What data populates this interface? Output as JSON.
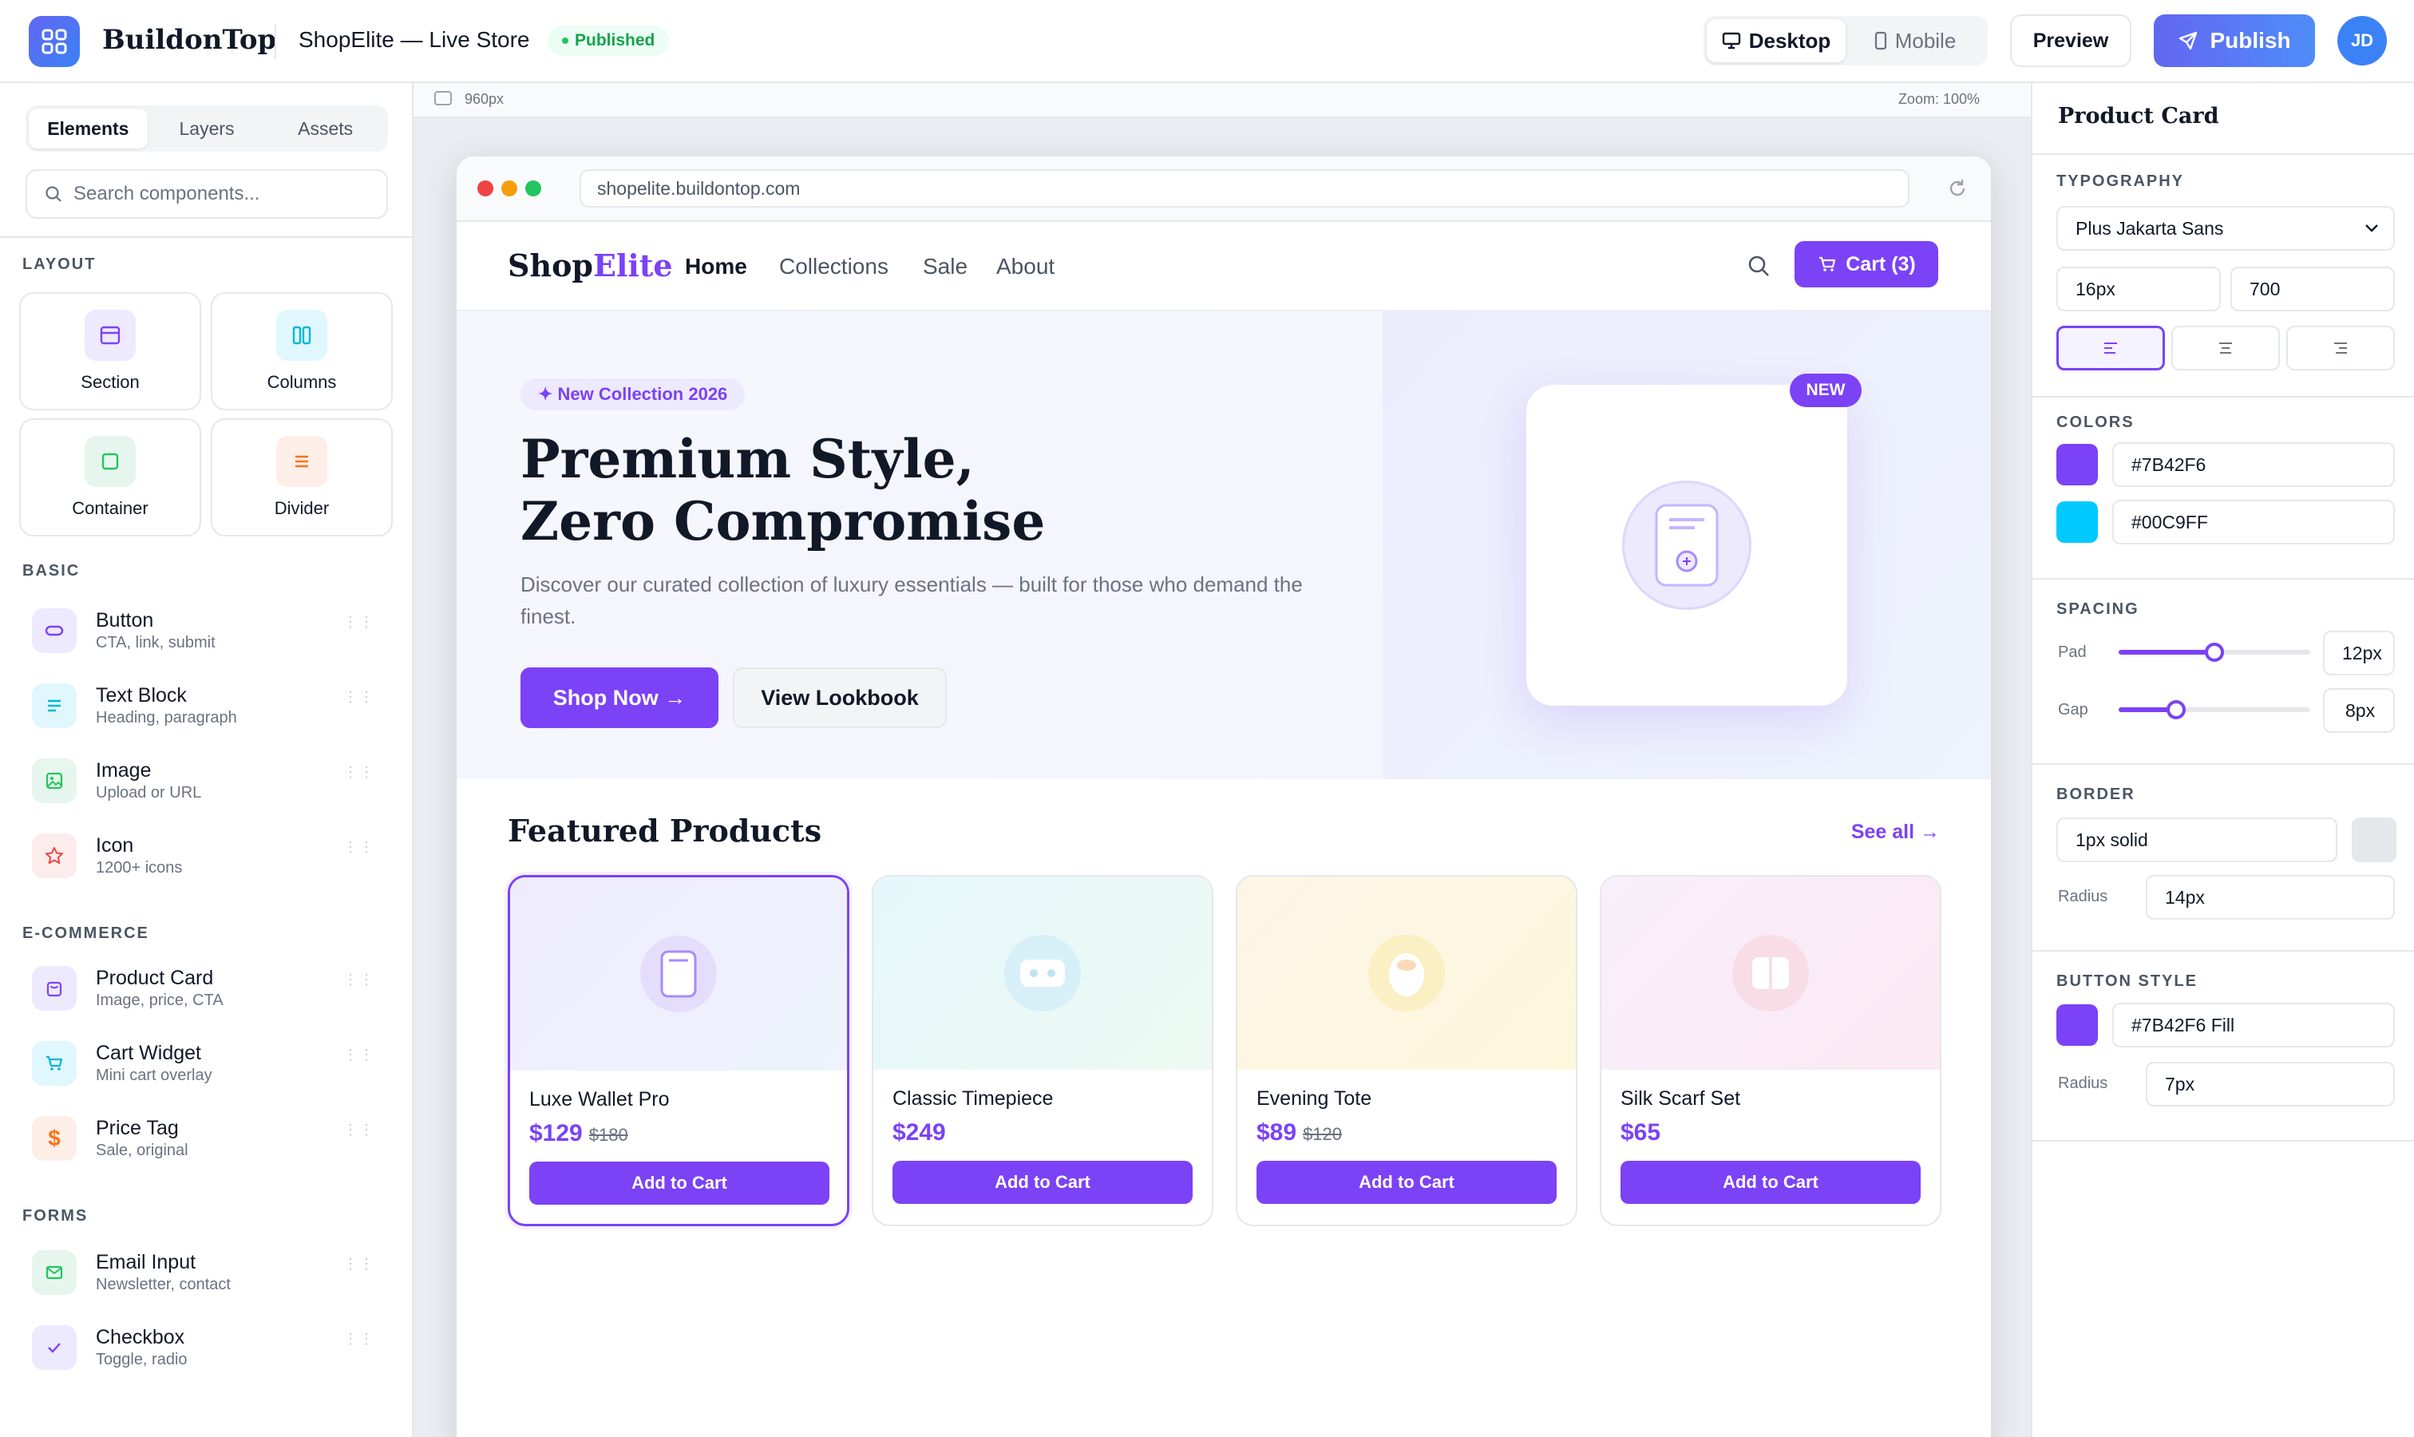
{
  "app": {
    "name": "BuildonTop",
    "store_name": "ShopElite — Live Store",
    "status": "Published"
  },
  "toolbar": {
    "devices": [
      {
        "label": "Desktop",
        "active": true
      },
      {
        "label": "Mobile",
        "active": false
      }
    ],
    "preview_label": "Preview",
    "publish_label": "Publish",
    "avatar_initials": "JD"
  },
  "left_panel": {
    "tabs": [
      {
        "label": "Elements",
        "active": true
      },
      {
        "label": "Layers",
        "active": false
      },
      {
        "label": "Assets",
        "active": false
      }
    ],
    "search_placeholder": "Search components...",
    "layout_title": "LAYOUT",
    "layout_items": [
      {
        "label": "Section",
        "icon": "section-icon"
      },
      {
        "label": "Columns",
        "icon": "columns-icon"
      },
      {
        "label": "Container",
        "icon": "container-icon"
      },
      {
        "label": "Divider",
        "icon": "divider-icon"
      }
    ],
    "basic_title": "BASIC",
    "basic_items": [
      {
        "label": "Button",
        "sub": "CTA, link, submit",
        "icon": "button-icon"
      },
      {
        "label": "Text Block",
        "sub": "Heading, paragraph",
        "icon": "text-icon"
      },
      {
        "label": "Image",
        "sub": "Upload or URL",
        "icon": "image-icon"
      },
      {
        "label": "Icon",
        "sub": "1200+ icons",
        "icon": "star-icon"
      }
    ],
    "ecommerce_title": "E-COMMERCE",
    "ecommerce_items": [
      {
        "label": "Product Card",
        "sub": "Image, price, CTA",
        "icon": "bag-icon"
      },
      {
        "label": "Cart Widget",
        "sub": "Mini cart overlay",
        "icon": "cart-icon"
      },
      {
        "label": "Price Tag",
        "sub": "Sale, original",
        "icon": "dollar-icon"
      }
    ],
    "forms_title": "FORMS",
    "forms_items": [
      {
        "label": "Email Input",
        "sub": "Newsletter, contact",
        "icon": "mail-icon"
      },
      {
        "label": "Checkbox",
        "sub": "Toggle, radio",
        "icon": "check-icon"
      }
    ]
  },
  "canvas": {
    "width_label": "960px",
    "zoom_label": "Zoom: 100%",
    "url": "shopelite.buildontop.com"
  },
  "site": {
    "logo_part1": "Shop",
    "logo_part2": "Elite",
    "nav": [
      {
        "label": "Home",
        "active": true
      },
      {
        "label": "Collections",
        "active": false
      },
      {
        "label": "Sale",
        "active": false
      },
      {
        "label": "About",
        "active": false
      }
    ],
    "cart_label": "Cart (3)",
    "hero": {
      "pill": "✦ New Collection 2026",
      "title_line1": "Premium Style,",
      "title_line2": "Zero Compromise",
      "subtitle": "Discover our curated collection of luxury essentials — built for those who demand the finest.",
      "primary_cta": "Shop Now →",
      "secondary_cta": "View Lookbook",
      "badge": "NEW"
    },
    "featured_title": "Featured Products",
    "see_all": "See all →",
    "products": [
      {
        "name": "Luxe Wallet Pro",
        "price": "$129",
        "old_price": "$180",
        "cta": "Add to Cart",
        "selected": true
      },
      {
        "name": "Classic Timepiece",
        "price": "$249",
        "old_price": "",
        "cta": "Add to Cart",
        "selected": false
      },
      {
        "name": "Evening Tote",
        "price": "$89",
        "old_price": "$120",
        "cta": "Add to Cart",
        "selected": false
      },
      {
        "name": "Silk Scarf Set",
        "price": "$65",
        "old_price": "",
        "cta": "Add to Cart",
        "selected": false
      }
    ]
  },
  "right_panel": {
    "title": "Product Card",
    "typography": {
      "title": "TYPOGRAPHY",
      "font": "Plus Jakarta Sans",
      "size": "16px",
      "weight": "700",
      "align_selected": "left"
    },
    "colors": {
      "title": "COLORS",
      "primary": "#7B42F6",
      "secondary": "#00C9FF"
    },
    "spacing": {
      "title": "SPACING",
      "pad_label": "Pad",
      "pad_value": "12px",
      "pad_level": 0.5,
      "gap_label": "Gap",
      "gap_value": "8px",
      "gap_level": 0.3
    },
    "border": {
      "title": "BORDER",
      "value": "1px solid",
      "radius_label": "Radius",
      "radius_value": "14px"
    },
    "button_style": {
      "title": "BUTTON STYLE",
      "color": "#7B42F6",
      "value": "#7B42F6 Fill",
      "radius_label": "Radius",
      "radius_value": "7px"
    }
  }
}
